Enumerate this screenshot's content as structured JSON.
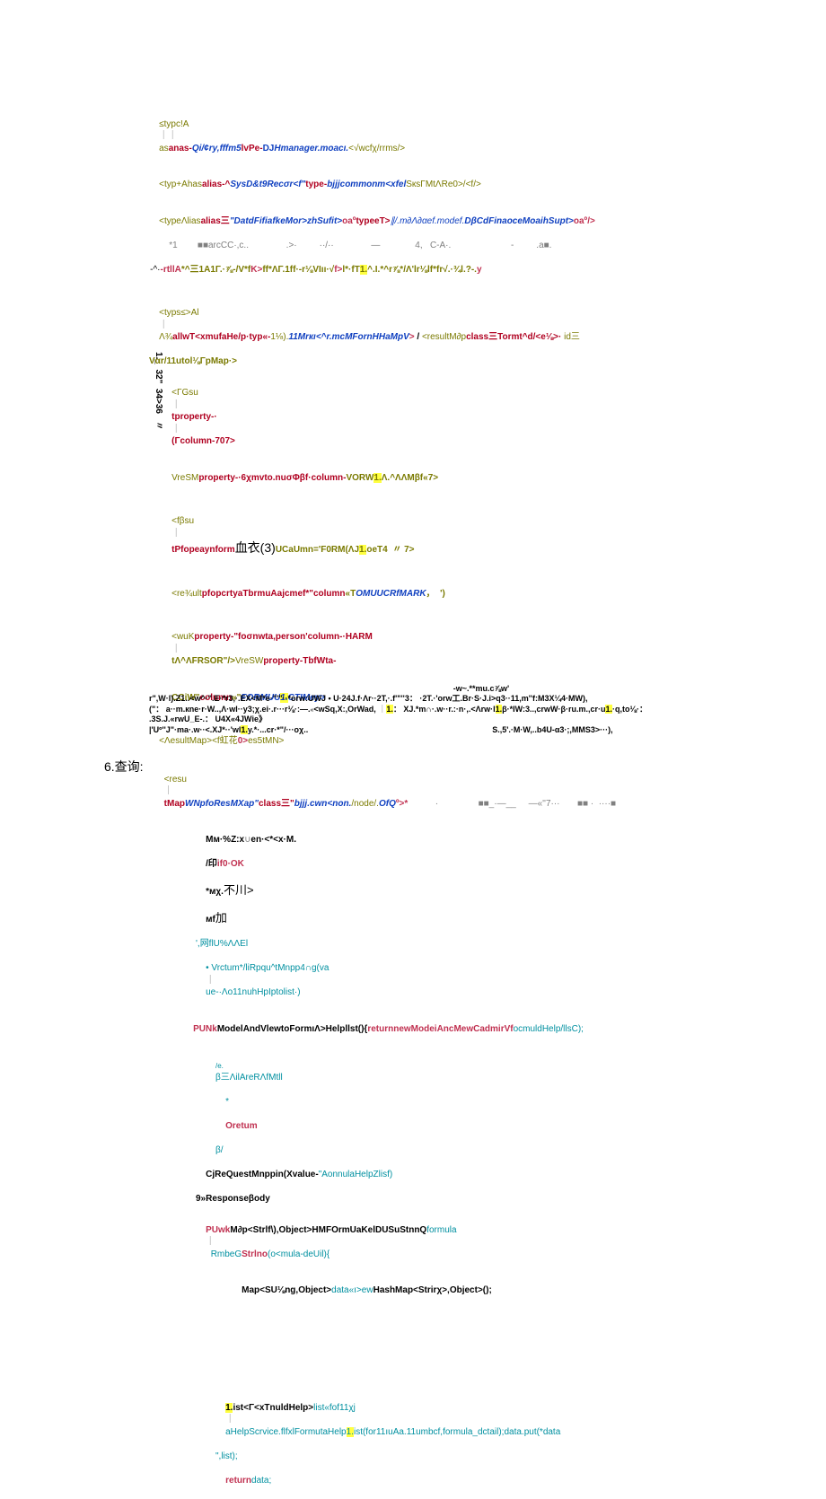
{
  "lines": {
    "l1_a": "≤typc!A",
    "l1_b": "as",
    "l1_c": "anas-",
    "l1_d": "Qi/¢ry,fffm5",
    "l1_e": "lvPe-",
    "l1_f": "DJ",
    "l1_g": "Hmanager.moacı.",
    "l1_h": "<√wcfχ/rrms/>",
    "l2_a": "<typ+Ahas",
    "l2_b": "alias-^",
    "l2_c": "SysD&t9Recσr<f\"",
    "l2_d": "type-",
    "l2_e": "bjjjcommonm<xfel",
    "l2_f": "SкsΓMtΛRe0>/<f/>",
    "l3_a": "<typeΛlias",
    "l3_b": "alias三",
    "l3_c": "\"DatdFifiafkeMor>zhSufit>",
    "l3_d": "oaº",
    "l3_e": "typeeT>",
    "l3_f": "∥/.m∂Λ∂αef.modef.",
    "l3_g": "DβCdFinaoceMoaihSupt>",
    "l3_h": "oaº/>",
    "l4": "        *1        ■■arcCC·,c..               .>·         ··/··               —              4,   C-A·.                        -         .a■.",
    "l5_a": "-^·",
    "l5_b": "-rtllA",
    "l5_c": "*^三1A1Γ.·⅞-/V*f",
    "l5_d": "K>",
    "l5_e": "ff*ΛΓ.1ff·-r⅛VIıı·√",
    "l5_f": "f>",
    "l5_g": "l*·fT",
    "l5_h": "1.",
    "l5_i": "^.I.*^r⅞*",
    "l5_j": "/Λ'lr⅛lf*fr√.·¾l.?-.",
    "l5_k": "y",
    "gap_a": " ",
    "l6_a": "<typs≤>Al",
    "l6_b": "Λ¾",
    "l6_c": "allwT<xmufaHe/p·",
    "l6_d": "typ«-",
    "l6_e": "1⅛).",
    "l6_f": "11Mrкı<^r.mcMFornHHaMpV",
    "l6_g": ">",
    "l6_h": " / ",
    "l6_i": "<resultM∂p",
    "l6_j": "class三Tormt^d/<e⅛>·",
    "l6_k": " id三",
    "l7": "Vαr/11utol⅛ΓpMap·>",
    "l8_a": "<ΓGsu",
    "l8_b": "tproperty-·",
    "l8_c": "(Γcolumn-707>",
    "l9_a": "VreSM",
    "l9_b": "property-·6χmvto.nuσΦβf·",
    "l9_c": "column-",
    "l9_d": "VORW",
    "l9_e": "1.",
    "l9_f": "Λ.^ΛΛMβf«7>",
    "l10_a": "<fβsu",
    "l10_b": "tPfopeaynform",
    "l10_c": "血衣(3)",
    "l10_d": "UCaUmn='F0RM(ΛJ",
    "l10_e": "1.",
    "l10_f": "oeT4  〃 7>",
    "l11_a": "<re¾ult",
    "l11_b": "pfopcrtyaTbrmuAajcmef*\"",
    "l11_c": "column",
    "l11_d": "«T",
    "l11_e": "OMUUCRfMARK",
    "l11_f": "，  ')",
    "l12_a": "<wuK",
    "l12_b": "property-\"foσnwta,person'",
    "l12_c": "column-·HARM",
    "l12_d": "tΛ^ΛFRSOR\"/>",
    "l12_e": "VreSW",
    "l12_f": "property-TbfWta-",
    "l13_a": "CCiW\"",
    "l13_b": "column",
    "l13_c": "«\"",
    "l13_d": "FORMUU",
    "l13_e": "1.",
    "l13_f": "CTIMey>",
    "l14_a": "<ΛesultMap>",
    "l14_b": "<f虹花",
    "l14_c": "0>",
    "l14_d": "es5tMN>",
    "label": "6.查询:",
    "l15_a": "<resu",
    "l15_b": "tMap",
    "l15_c": "WNpfoResMXap\"",
    "l15_d": "class三\"",
    "l15_e": "bjjj.cwn<non.",
    "l15_f": "/node/.",
    "l15_g": "OfQ",
    "l15_h": "º>*",
    "l15_tail": "           ·                ■■_·—__     —«''7···       ■■ ·  ····■",
    "l16_a": "Mм·%Z:x",
    "l16_b": "∪",
    "l16_c": "en·<*<x·M.",
    "l16_d": "/印",
    "l16_e": "if0·OK",
    "l16_f": "*мχ.",
    "l16_g": "不川>",
    "l16_h": "мf",
    "l16_i": "加",
    "l17": "',网flU%ΛΛEl",
    "l18_a": "• Vrctum*/liRpqu^tMnpp4∩g(va",
    "l18_b": "ue-·Λo11nuhHpIptolist·)",
    "l19_a": "PUNk",
    "l19_b": "ModelAndVlewtoFormıΛ>Helpllst(){",
    "l19_c": "return",
    "l19_d": "newModeiAncMewCadmirVf",
    "l19_e": "ocmuldHelp/llsC);",
    "l20": "/e.",
    "l21": "β三ΛilAreRΛfMtll",
    "l22a": "*",
    "l22b": "Oretum",
    "l23": "β/",
    "l24_a": "CjReQuestMnppin(Xvalue-",
    "l24_b": "\"AonnulaHelpZlisf)",
    "l25": "9»Responseβody",
    "l26_a": "PUwk",
    "l26_b": "M∂p<Strlf\\),Object>HMFOrmUaKelDUSuStnnQ",
    "l26_c": "formula",
    "l26_d": "RmbeG",
    "l26_e": "Strlno",
    "l26_f": "(o<mula-deUil){",
    "l27_a": "Map<SU⅛ng,Object>",
    "l27_b": "data«ı>ew",
    "l27_c": "HashMap<Strirχ>,Object>();",
    "l28_a": "1.",
    "l28_b": "ist<Γ<xTnuldHelp>",
    "l28_c": "list«fof11χj",
    "l28_d": "aHelpScrvice.flfxlFormutaHelp",
    "l28_e": "1.",
    "l28_f": "ist(for11ıuAa.11umbcf,formula_dctail);data.put(*data",
    "l29": "\",list);",
    "l30_a": "return",
    "l30_b": "data;",
    "rot": "1._  32\"  34>36   〃",
    "f0": "-w~.**mu.c⅞w'",
    "f1": "r\",W·l).Z1..<w^·\".E·*r3,·.EX<M*e·\"'\"··*orw:UWJ  •  U·24J.f·Λr··2T,·.f'\"''3：  ·2T.·'orw工.Br·S·J.i>q3··11,m''f:M3X¼4·MW),",
    "f2_a": "(\"：   a··m.кne·r·W..,Λ·wl··y3;χ.ei·.r···r⅛·:—.",
    "f2_b": "«",
    "f2_c": "<wSq,X:,OrWad,",
    "f2_d": "1.",
    "f2_e": "：   XJ.*m∩·.w··r.:·n·,.<Λrw·l",
    "f2_f": "1.",
    "f2_g": "β·*IW:3..,crwW·β·ru.m.,cr·u",
    "f2_h": "1.",
    "f2_i": "·q,to⅛·：",
    "f3": ".3S.J.«rwU_E-.：  U4X«4JWie》",
    "f4_a": "|'Uº''J\"·ma·.w··<.XJ*··'wl",
    "f4_b": "1.",
    "f4_c": "y.*·...cr·*\"/···oχ..",
    "f4_tail": "S.,5'.·M·W,..b4U-α3·;,MMS3>···),"
  }
}
